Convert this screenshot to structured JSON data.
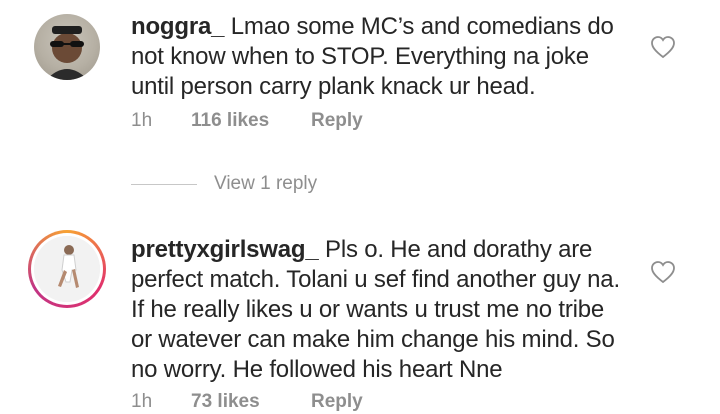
{
  "comments": [
    {
      "username": "noggra_",
      "text": "Lmao some MC’s and comedians do not know when to STOP. Everything na joke until person carry plank knack ur head.",
      "time": "1h",
      "likes": "116 likes",
      "reply_label": "Reply",
      "avatar_icon": "user-avatar-sunglasses",
      "like_icon": "heart-outline-icon"
    },
    {
      "username": "prettyxgirlswag_",
      "text": "Pls o. He and dorathy are perfect match. Tolani u sef find another guy na. If he really likes u or wants u trust me no tribe or watever can make him change his mind. So no worry. He followed his heart Nne",
      "time": "1h",
      "likes": "73 likes",
      "reply_label": "Reply",
      "avatar_icon": "user-avatar-story-ring",
      "like_icon": "heart-outline-icon"
    }
  ],
  "view_replies_label": "View 1 reply",
  "colors": {
    "text": "#262626",
    "secondary": "#8e8e8e",
    "divider": "#c7c7c7",
    "story_ring": "#e1306c"
  }
}
